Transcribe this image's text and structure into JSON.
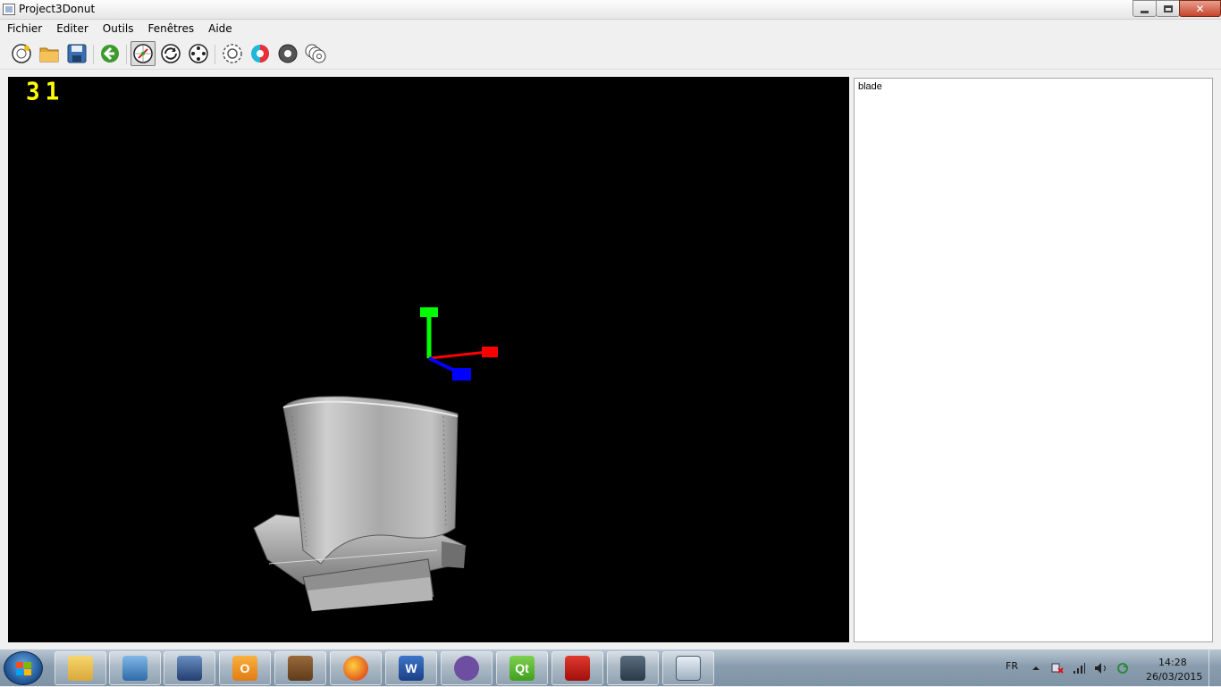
{
  "window": {
    "title": "Project3Donut"
  },
  "menu": {
    "items": [
      "Fichier",
      "Editer",
      "Outils",
      "Fenêtres",
      "Aide"
    ]
  },
  "toolbar": {
    "buttons": [
      {
        "name": "new-icon",
        "active": false
      },
      {
        "name": "open-folder-icon",
        "active": false
      },
      {
        "name": "save-icon",
        "active": false
      },
      {
        "name": "back-arrow-icon",
        "active": false
      },
      {
        "name": "view-mode-icon",
        "active": true
      },
      {
        "name": "rotate-icon",
        "active": false
      },
      {
        "name": "move-icon",
        "active": false
      },
      {
        "name": "gear-icon",
        "active": false
      },
      {
        "name": "color-wheel-icon",
        "active": false
      },
      {
        "name": "disc-icon",
        "active": false
      },
      {
        "name": "multi-disc-icon",
        "active": false
      }
    ]
  },
  "viewport": {
    "fps_counter": "31",
    "axes": {
      "x_color": "#ff0000",
      "y_color": "#00ff00",
      "z_color": "#0000ff"
    }
  },
  "side_panel": {
    "items": [
      "blade"
    ]
  },
  "taskbar": {
    "apps": [
      "explorer-icon",
      "control-panel-icon",
      "virtualbox-icon",
      "outlook-icon",
      "notebook-icon",
      "firefox-icon",
      "word-icon",
      "github-icon",
      "qt-icon",
      "acrobat-icon",
      "system-monitor-icon",
      "window-app-icon"
    ],
    "language": "FR",
    "time": "14:28",
    "date": "26/03/2015"
  }
}
